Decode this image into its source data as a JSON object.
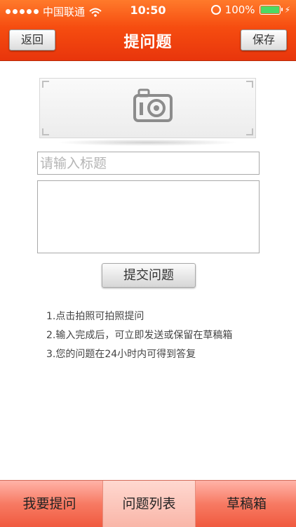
{
  "status_bar": {
    "carrier": "中国联通",
    "time": "10:50",
    "battery": "100%"
  },
  "nav": {
    "back_label": "返回",
    "title": "提问题",
    "save_label": "保存"
  },
  "form": {
    "title_placeholder": "请输入标题",
    "submit_label": "提交问题"
  },
  "tips": [
    "1.点击拍照可拍照提问",
    "2.输入完成后，可立即发送或保留在草稿箱",
    "3.您的问题在24小时内可得到答复"
  ],
  "tabs": [
    {
      "label": "我要提问"
    },
    {
      "label": "问题列表"
    },
    {
      "label": "草稿箱"
    }
  ],
  "colors": {
    "header_accent": "#f64d10",
    "battery_fill": "#4cd964"
  },
  "icons": [
    "camera-icon",
    "wifi-icon",
    "battery-icon",
    "rotation-lock-icon"
  ]
}
